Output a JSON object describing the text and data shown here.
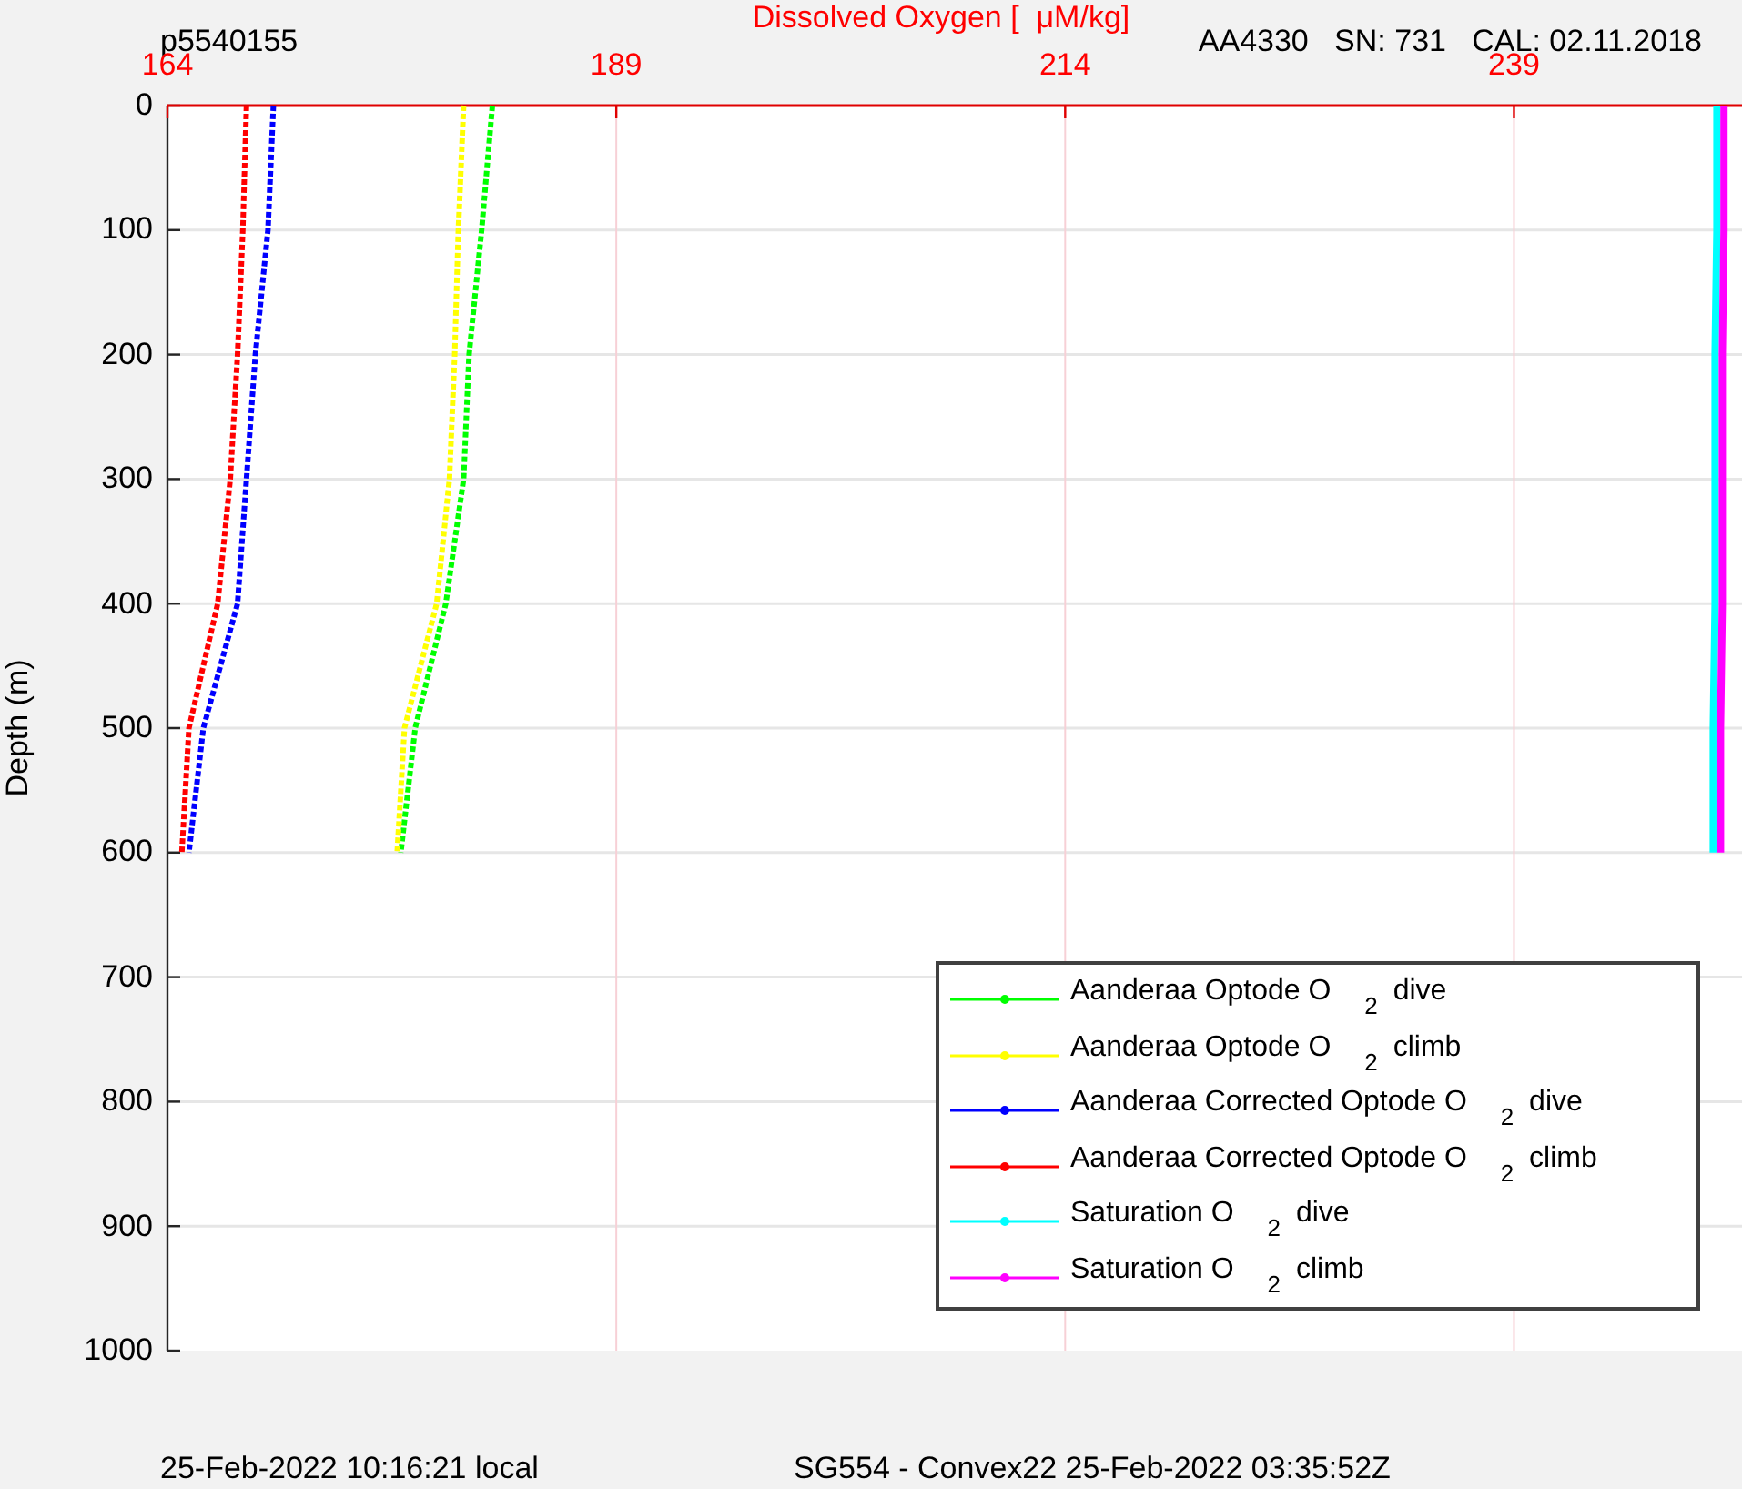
{
  "figure": {
    "profile_label": "p5540155",
    "sensor_label": "AA4330   SN: 731   CAL: 02.11.2018",
    "footer_left": "25-Feb-2022 10:16:21 local",
    "footer_right": "SG554 - Convex22 25-Feb-2022 03:35:52Z",
    "chart_data": {
      "type": "line",
      "orientation": "horizontal",
      "xlabel": "Dissolved Oxygen [  μM/kg]",
      "ylabel": "Depth (m)",
      "categories": [
        "0",
        "100",
        "200",
        "300",
        "400",
        "500",
        "600",
        "700",
        "800",
        "900",
        "1000"
      ],
      "xlim": [
        164,
        251.7
      ],
      "xticks": [
        164,
        189,
        214,
        239
      ],
      "grid": true,
      "legend": true,
      "series": [
        {
          "name": "Aanderaa Optode O $_{2}$ dive",
          "color": "#00ff00",
          "line_style": "dotted",
          "values": [
            182.1,
            181.5,
            180.8,
            180.5,
            179.5,
            177.8,
            177,
            null,
            null,
            null,
            null
          ]
        },
        {
          "name": "Aanderaa Optode O $_{2}$ climb",
          "color": "#ffff00",
          "line_style": "dotted",
          "values": [
            180.5,
            180.2,
            180,
            179.7,
            179,
            177.2,
            176.8,
            null,
            null,
            null,
            null
          ]
        },
        {
          "name": "Aanderaa Corrected Optode O $_{2}$ dive",
          "color": "#0000ff",
          "line_style": "dotted",
          "values": [
            169.9,
            169.6,
            168.9,
            168.4,
            167.9,
            166,
            165.2,
            null,
            null,
            null,
            null
          ]
        },
        {
          "name": "Aanderaa Corrected Optode O $_{2}$ climb",
          "color": "#ff0000",
          "line_style": "dotted",
          "values": [
            168.4,
            168.2,
            167.9,
            167.5,
            166.8,
            165.2,
            164.8,
            null,
            null,
            null,
            null
          ]
        },
        {
          "name": "Saturation O $_{2}$ dive",
          "color": "#00ffff",
          "line_style": "solid",
          "values": [
            250.3,
            250.3,
            250.2,
            250.2,
            250.2,
            250.1,
            250.1,
            null,
            null,
            null,
            null
          ]
        },
        {
          "name": "Saturation O $_{2}$ climb",
          "color": "#ff00ff",
          "line_style": "solid",
          "values": [
            250.7,
            250.7,
            250.6,
            250.6,
            250.6,
            250.5,
            250.5,
            null,
            null,
            null,
            null
          ]
        }
      ]
    }
  }
}
